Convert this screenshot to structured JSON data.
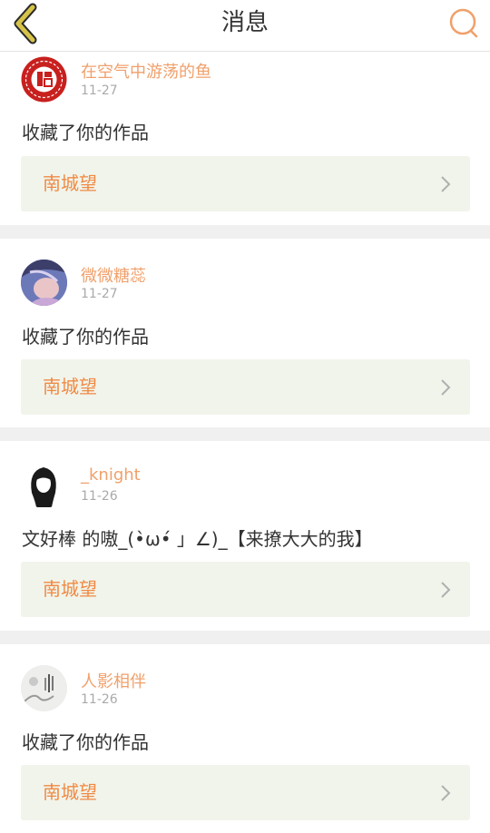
{
  "header": {
    "title": "消息"
  },
  "messages": [
    {
      "user": "在空气中游荡的鱼",
      "date": "11-27",
      "text": "收藏了你的作品",
      "work": "南城望"
    },
    {
      "user": "微微糖蕊",
      "date": "11-27",
      "text": "收藏了你的作品",
      "work": "南城望"
    },
    {
      "user": "_knight",
      "date": "11-26",
      "text": "文好棒 的嗷_(•̀ω•́ 」∠)_【来撩大大的我】",
      "work": "南城望"
    },
    {
      "user": "人影相伴",
      "date": "11-26",
      "text": "收藏了你的作品",
      "work": "南城望"
    }
  ],
  "colors": {
    "accent": "#f0a06b",
    "work_bg": "#f1f4ea",
    "back_icon": "#d6c44a",
    "search_icon": "#f0a06b"
  },
  "icons": {
    "back": "chevron-left-icon",
    "search": "search-icon",
    "arrow": "chevron-right-icon"
  }
}
